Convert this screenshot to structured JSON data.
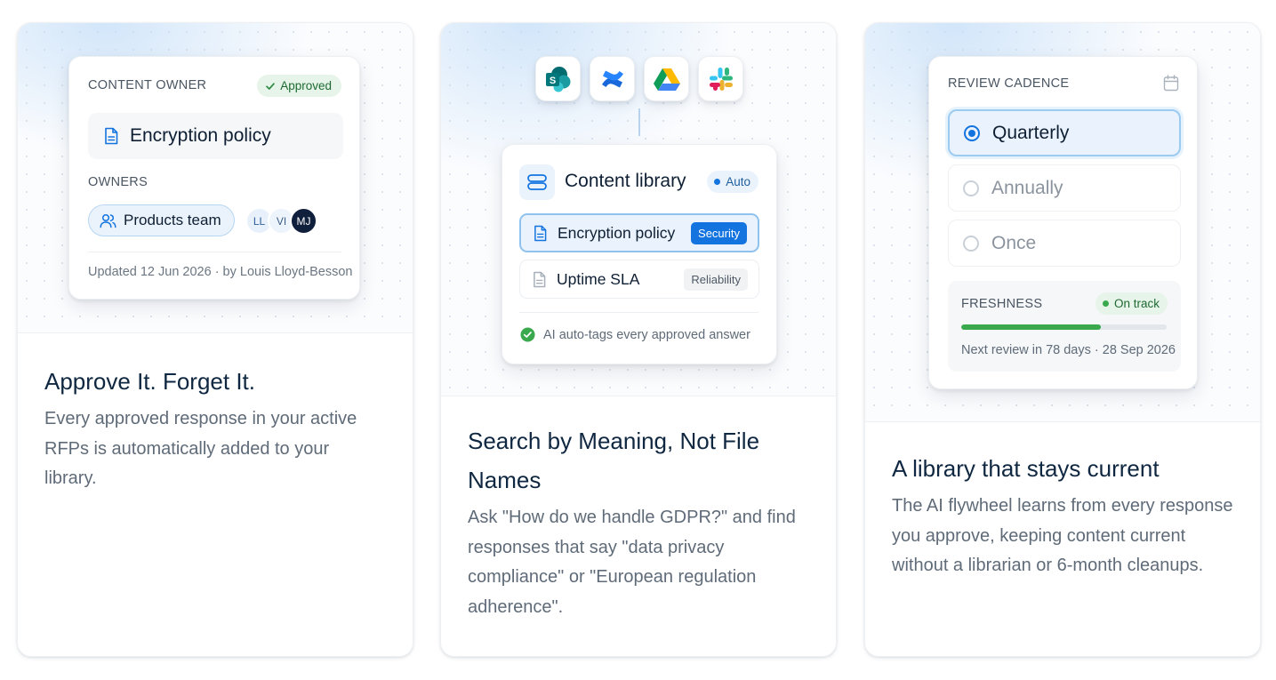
{
  "cards": [
    {
      "title": "Approve It. Forget It.",
      "description": "Every approved response in your active RFPs is automatically added to your library.",
      "panel": {
        "label": "CONTENT OWNER",
        "status_badge": "Approved",
        "document": "Encryption policy",
        "owners_label": "OWNERS",
        "team": "Products team",
        "avatars": [
          "LL",
          "VI",
          "MJ"
        ],
        "updated": "Updated 12 Jun 2026 · by Louis Lloyd-Besson"
      }
    },
    {
      "title": "Search by Meaning, Not File Names",
      "description": "Ask \"How do we handle GDPR?\" and find responses that say \"data privacy compliance\" or \"European regulation adherence\".",
      "integrations": [
        "sharepoint-icon",
        "confluence-icon",
        "google-drive-icon",
        "slack-icon"
      ],
      "panel": {
        "title": "Content library",
        "status_badge": "Auto",
        "items": [
          {
            "label": "Encryption policy",
            "tag": "Security",
            "selected": true
          },
          {
            "label": "Uptime SLA",
            "tag": "Reliability",
            "selected": false
          }
        ],
        "footer": "AI auto-tags every approved answer"
      }
    },
    {
      "title": "A library that stays current",
      "description": "The AI flywheel learns from every response you approve, keeping content current without a librarian or 6-month cleanups.",
      "panel": {
        "label": "REVIEW CADENCE",
        "options": [
          {
            "label": "Quarterly",
            "selected": true
          },
          {
            "label": "Annually",
            "selected": false
          },
          {
            "label": "Once",
            "selected": false
          }
        ],
        "freshness_label": "FRESHNESS",
        "freshness_badge": "On track",
        "freshness_progress": 0.68,
        "next_review": "Next review in 78 days · 28 Sep 2026"
      }
    }
  ],
  "colors": {
    "accent": "#1374df",
    "success": "#3aa94d",
    "title": "#0f2740",
    "body": "#5f6b78"
  }
}
